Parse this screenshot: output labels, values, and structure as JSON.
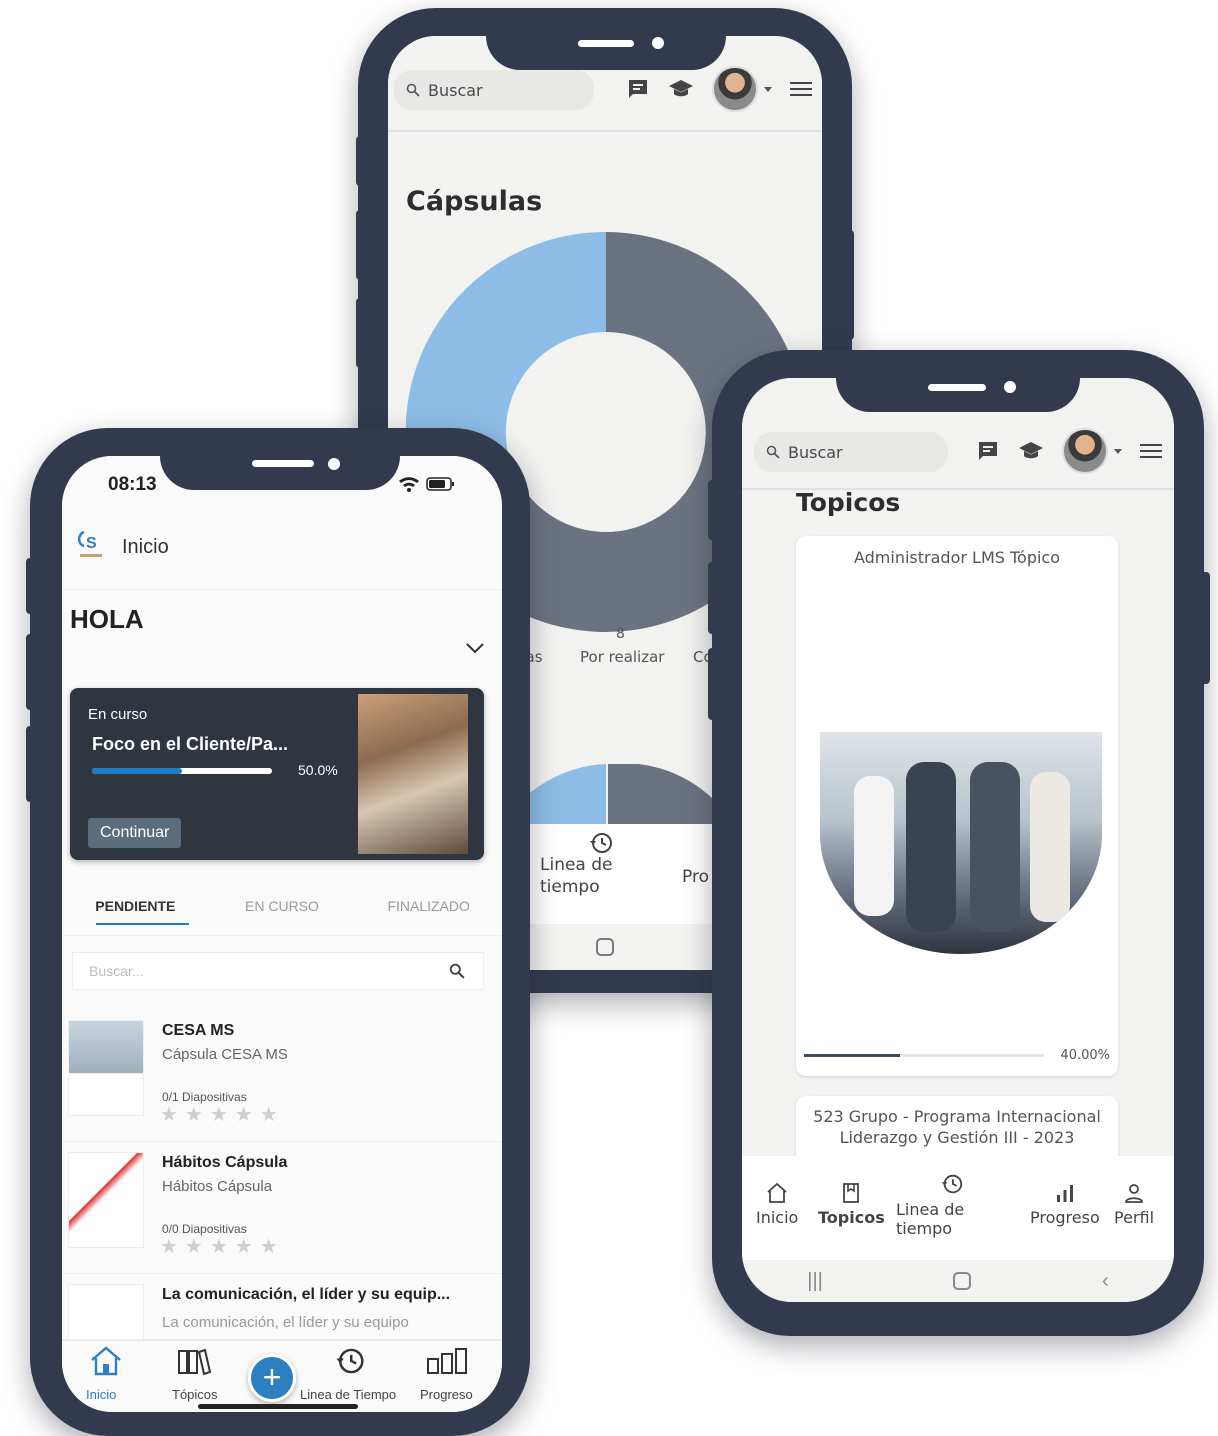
{
  "capsulas_screen": {
    "search_placeholder": "Buscar",
    "title": "Cápsulas",
    "legend_count": "8",
    "legend_left": "das",
    "legend_mid": "Por realizar",
    "legend_right": "Co",
    "nav_timeline_line1": "Linea de",
    "nav_timeline_line2": "tiempo",
    "nav_progress_partial": "Pro",
    "colors": {
      "donut_blue": "#8dbde6",
      "donut_gray": "#6c7380"
    }
  },
  "topicos_screen": {
    "search_placeholder": "Buscar",
    "title": "Topicos",
    "card1": {
      "title": "Administrador LMS Tópico",
      "progress_label": "40.00%",
      "progress": 0.4
    },
    "card2": {
      "title_line1": "523 Grupo - Programa Internacional",
      "title_line2": "Liderazgo y Gestión III - 2023"
    },
    "nav": {
      "inicio": "Inicio",
      "topicos": "Topicos",
      "timeline_line1": "Linea de",
      "timeline_line2": "tiempo",
      "progreso": "Progreso",
      "perfil": "Perfil"
    }
  },
  "home_screen": {
    "status_time": "08:13",
    "app_title": "Inicio",
    "greeting": "HOLA",
    "current_card": {
      "kicker": "En curso",
      "title": "Foco en el Cliente/Pa...",
      "progress_label": "50.0%",
      "progress": 0.5,
      "button": "Continuar"
    },
    "tabs": [
      "PENDIENTE",
      "EN CURSO",
      "FINALIZADO"
    ],
    "search_placeholder": "Buscar...",
    "items": [
      {
        "title": "CESA MS",
        "subtitle": "Cápsula CESA MS",
        "meta": "0/1  Diapositivas",
        "stars": "★★★★★",
        "rating": 0
      },
      {
        "title": "Hábitos Cápsula",
        "subtitle": "Hábitos Cápsula",
        "meta": "0/0  Diapositivas",
        "stars": "★★★★★",
        "rating": 0
      },
      {
        "title": "La comunicación, el líder y su equip...",
        "subtitle": "La comunicación, el líder y su equipo",
        "meta": "",
        "stars": "",
        "rating": 0
      }
    ],
    "nav": {
      "inicio": "Inicio",
      "topicos": "Tópicos",
      "timeline": "Linea de Tiempo",
      "progreso": "Progreso"
    },
    "fab_symbol": "+",
    "colors": {
      "accent": "#1f7ac4",
      "card_bg": "#2f3640",
      "frame": "#343a4e"
    }
  }
}
